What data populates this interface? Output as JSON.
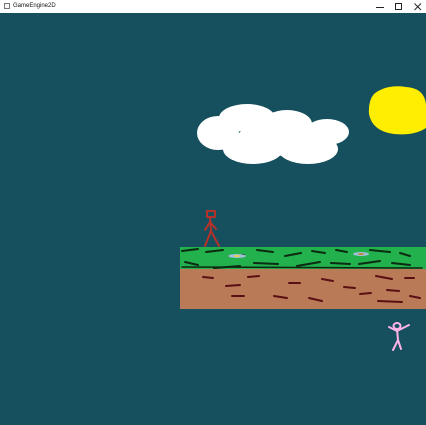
{
  "window": {
    "title": "GameEngine2D",
    "icon": "app-window-icon",
    "controls": [
      "minimize-icon",
      "maximize-icon",
      "close-icon"
    ]
  },
  "scene": {
    "background_color": "#16505f",
    "sun_color": "#ffee00",
    "cloud_color": "#ffffff",
    "grass_color": "#22b14c",
    "dirt_color": "#b97a57",
    "player_color": "#b5322a",
    "enemy_color": "#ffb3e6"
  }
}
